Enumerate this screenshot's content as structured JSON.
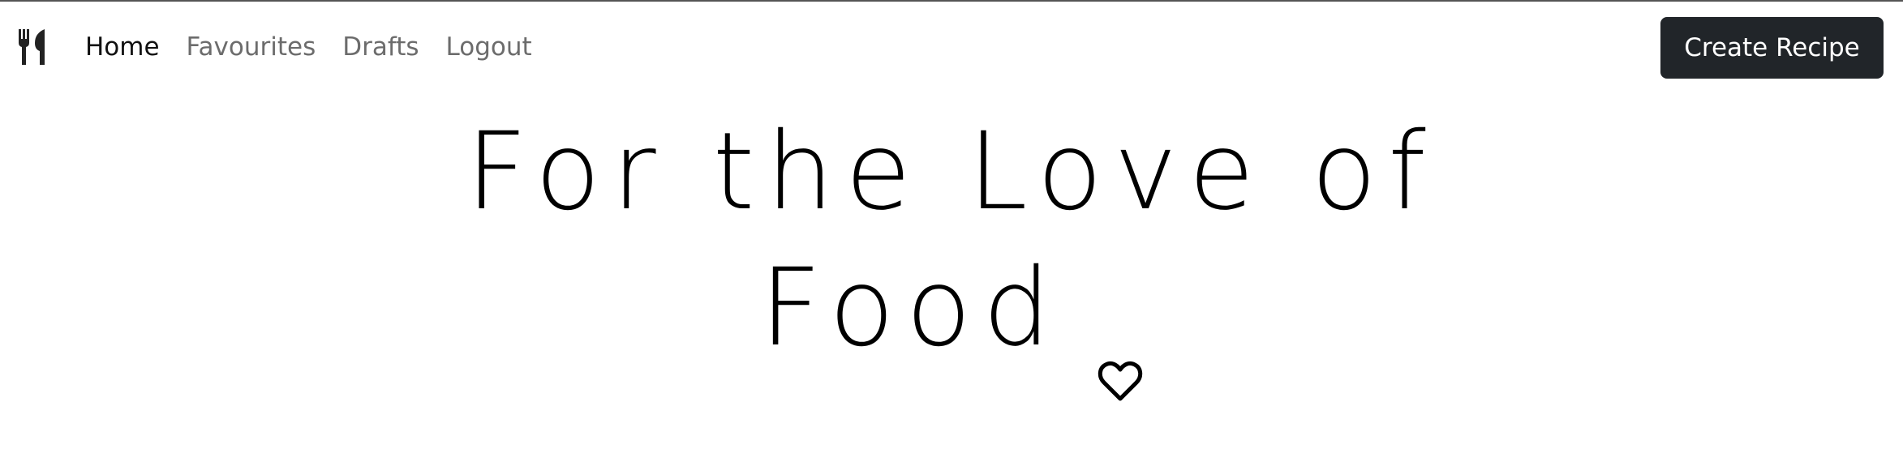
{
  "nav": {
    "brand_icon": "utensils-icon",
    "links": [
      {
        "label": "Home",
        "active": true
      },
      {
        "label": "Favourites",
        "active": false
      },
      {
        "label": "Drafts",
        "active": false
      },
      {
        "label": "Logout",
        "active": false
      }
    ],
    "create_button_label": "Create Recipe"
  },
  "hero": {
    "line1": "For the Love of",
    "line2": "Food",
    "icon": "heart-outline-icon"
  },
  "colors": {
    "button_bg": "#212529",
    "nav_active": "#111111",
    "nav_inactive": "#6c6c6c"
  }
}
